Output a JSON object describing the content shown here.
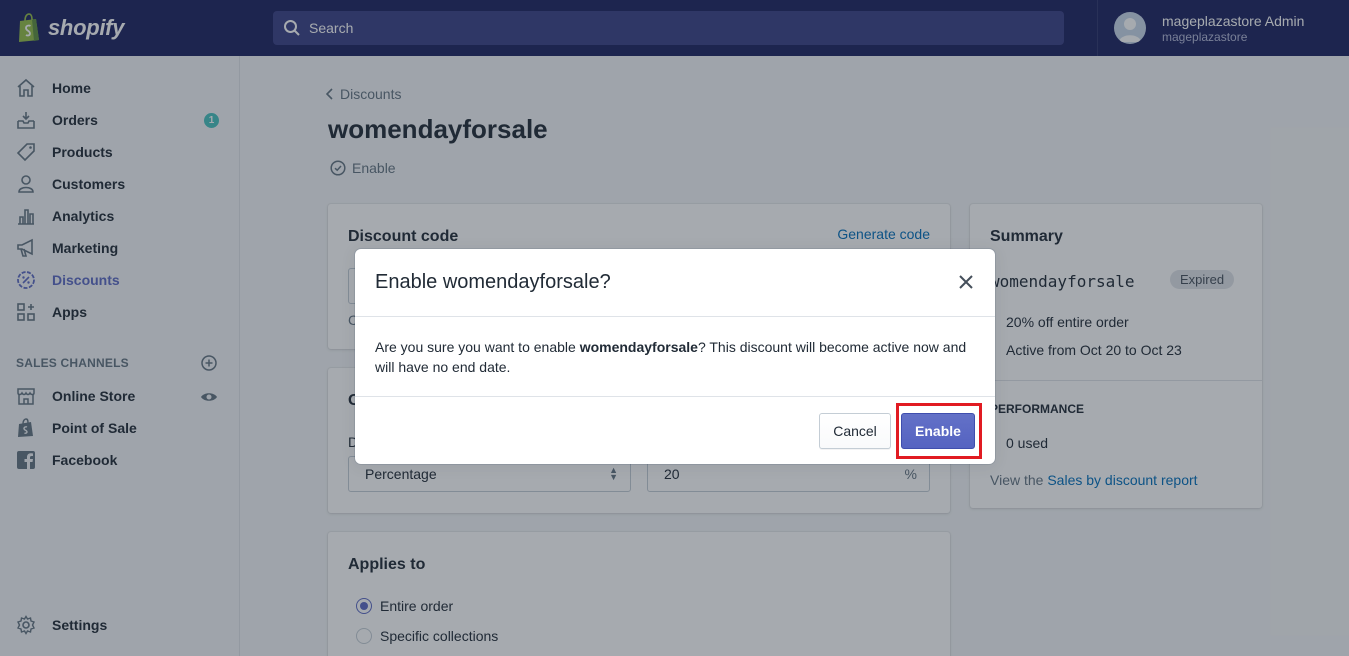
{
  "brand": {
    "logo_text": "shopify"
  },
  "search": {
    "placeholder": "Search"
  },
  "user": {
    "name": "mageplazastore Admin",
    "store": "mageplazastore"
  },
  "sidebar": {
    "items": [
      {
        "label": "Home",
        "icon": "home-icon"
      },
      {
        "label": "Orders",
        "icon": "orders-icon",
        "badge": "1"
      },
      {
        "label": "Products",
        "icon": "tag-icon"
      },
      {
        "label": "Customers",
        "icon": "person-icon"
      },
      {
        "label": "Analytics",
        "icon": "bar-chart-icon"
      },
      {
        "label": "Marketing",
        "icon": "megaphone-icon"
      },
      {
        "label": "Discounts",
        "icon": "discount-icon",
        "active": true
      },
      {
        "label": "Apps",
        "icon": "apps-icon"
      }
    ],
    "sales_channels_heading": "SALES CHANNELS",
    "channels": [
      {
        "label": "Online Store",
        "icon": "store-icon"
      },
      {
        "label": "Point of Sale",
        "icon": "pos-bag-icon"
      },
      {
        "label": "Facebook",
        "icon": "facebook-icon"
      }
    ],
    "settings_label": "Settings"
  },
  "page": {
    "breadcrumb": "Discounts",
    "title": "womendayforsale",
    "status_action": "Enable"
  },
  "discount_code_card": {
    "title": "Discount code",
    "generate_link": "Generate code",
    "code_value": "",
    "help_text": "C"
  },
  "options_card": {
    "title": "O",
    "type_label": "D",
    "type_value": "Percentage",
    "value": "20",
    "value_suffix": "%"
  },
  "applies_card": {
    "title": "Applies to",
    "options": [
      "Entire order",
      "Specific collections"
    ],
    "selected": "Entire order"
  },
  "summary": {
    "title": "Summary",
    "code": "womendayforsale",
    "status_badge": "Expired",
    "details": [
      "20% off entire order",
      "Active from Oct 20 to Oct 23"
    ],
    "performance_heading": "PERFORMANCE",
    "used": "0 used",
    "report_prefix": "View the",
    "report_link": "Sales by discount report"
  },
  "modal": {
    "title": "Enable womendayforsale?",
    "body_prefix": "Are you sure you want to enable",
    "body_bold": "womendayforsale",
    "body_suffix": "? This discount will become active now and will have no end date.",
    "cancel_label": "Cancel",
    "confirm_label": "Enable"
  },
  "colors": {
    "topbar": "#1c2260",
    "accent": "#5c6ac4",
    "link": "#006fbb",
    "badge": "#47c1bf",
    "highlight": "#e11b22"
  }
}
